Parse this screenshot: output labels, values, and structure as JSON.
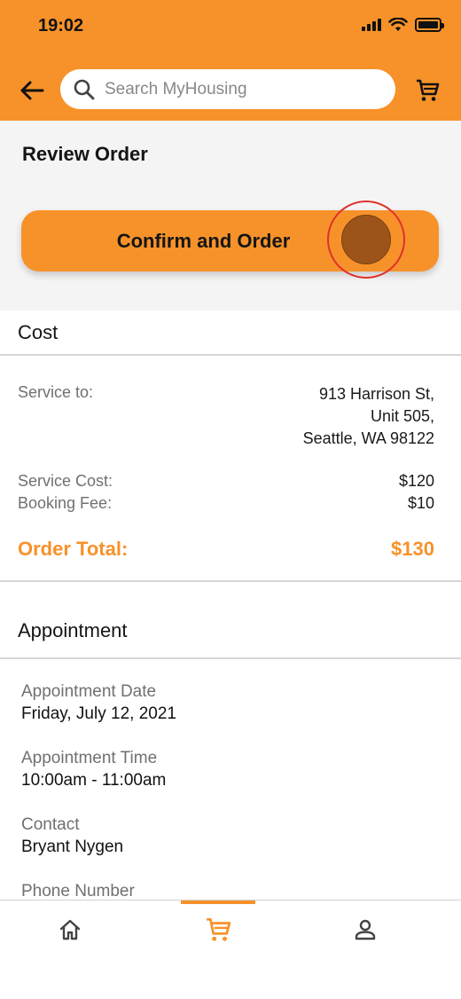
{
  "status_bar": {
    "time": "19:02"
  },
  "header": {
    "search": {
      "placeholder": "Search MyHousing",
      "value": ""
    },
    "icons": {
      "back": "arrow-left-icon",
      "cart": "shopping-cart-icon"
    }
  },
  "review": {
    "title": "Review Order",
    "confirm_label": "Confirm and Order"
  },
  "cost": {
    "section_title": "Cost",
    "service_to_label": "Service to:",
    "address_lines": [
      "913 Harrison St,",
      "Unit 505,",
      "Seattle, WA 98122"
    ],
    "service_cost_label": "Service Cost:",
    "service_cost_value": "$120",
    "booking_fee_label": "Booking Fee:",
    "booking_fee_value": "$10",
    "order_total_label": "Order Total:",
    "order_total_value": "$130"
  },
  "appointment": {
    "section_title": "Appointment",
    "fields": [
      {
        "label": "Appointment Date",
        "value": "Friday, July 12, 2021"
      },
      {
        "label": "Appointment Time",
        "value": "10:00am - 11:00am"
      },
      {
        "label": "Contact",
        "value": "Bryant Nygen"
      },
      {
        "label": "Phone Number",
        "value": ""
      }
    ]
  },
  "bottom_nav": {
    "items": [
      {
        "icon": "home-icon",
        "active": false
      },
      {
        "icon": "shopping-cart-icon",
        "active": true
      },
      {
        "icon": "person-icon",
        "active": false
      }
    ]
  },
  "colors": {
    "accent": "#f7922a",
    "tap_indicator_ring": "#e0302a",
    "tap_indicator_fill": "#9c541a"
  }
}
